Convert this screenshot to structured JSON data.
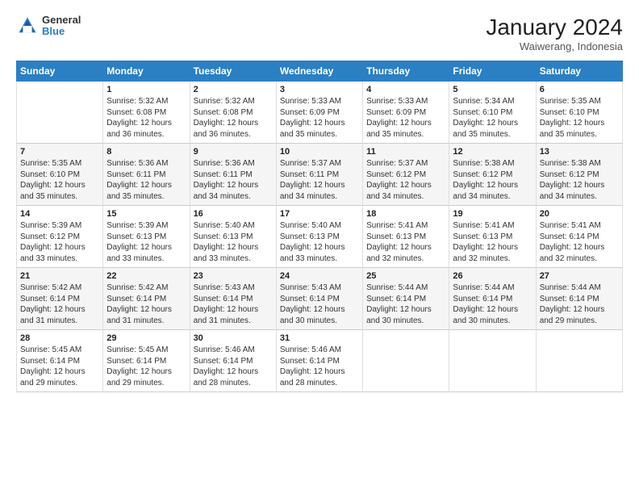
{
  "logo": {
    "general": "General",
    "blue": "Blue"
  },
  "title": {
    "month": "January 2024",
    "location": "Waiwerang, Indonesia"
  },
  "headers": [
    "Sunday",
    "Monday",
    "Tuesday",
    "Wednesday",
    "Thursday",
    "Friday",
    "Saturday"
  ],
  "weeks": [
    [
      {
        "day": "",
        "info": ""
      },
      {
        "day": "1",
        "info": "Sunrise: 5:32 AM\nSunset: 6:08 PM\nDaylight: 12 hours and 36 minutes."
      },
      {
        "day": "2",
        "info": "Sunrise: 5:32 AM\nSunset: 6:08 PM\nDaylight: 12 hours and 36 minutes."
      },
      {
        "day": "3",
        "info": "Sunrise: 5:33 AM\nSunset: 6:09 PM\nDaylight: 12 hours and 35 minutes."
      },
      {
        "day": "4",
        "info": "Sunrise: 5:33 AM\nSunset: 6:09 PM\nDaylight: 12 hours and 35 minutes."
      },
      {
        "day": "5",
        "info": "Sunrise: 5:34 AM\nSunset: 6:10 PM\nDaylight: 12 hours and 35 minutes."
      },
      {
        "day": "6",
        "info": "Sunrise: 5:35 AM\nSunset: 6:10 PM\nDaylight: 12 hours and 35 minutes."
      }
    ],
    [
      {
        "day": "7",
        "info": "Sunrise: 5:35 AM\nSunset: 6:10 PM\nDaylight: 12 hours and 35 minutes."
      },
      {
        "day": "8",
        "info": "Sunrise: 5:36 AM\nSunset: 6:11 PM\nDaylight: 12 hours and 35 minutes."
      },
      {
        "day": "9",
        "info": "Sunrise: 5:36 AM\nSunset: 6:11 PM\nDaylight: 12 hours and 34 minutes."
      },
      {
        "day": "10",
        "info": "Sunrise: 5:37 AM\nSunset: 6:11 PM\nDaylight: 12 hours and 34 minutes."
      },
      {
        "day": "11",
        "info": "Sunrise: 5:37 AM\nSunset: 6:12 PM\nDaylight: 12 hours and 34 minutes."
      },
      {
        "day": "12",
        "info": "Sunrise: 5:38 AM\nSunset: 6:12 PM\nDaylight: 12 hours and 34 minutes."
      },
      {
        "day": "13",
        "info": "Sunrise: 5:38 AM\nSunset: 6:12 PM\nDaylight: 12 hours and 34 minutes."
      }
    ],
    [
      {
        "day": "14",
        "info": "Sunrise: 5:39 AM\nSunset: 6:12 PM\nDaylight: 12 hours and 33 minutes."
      },
      {
        "day": "15",
        "info": "Sunrise: 5:39 AM\nSunset: 6:13 PM\nDaylight: 12 hours and 33 minutes."
      },
      {
        "day": "16",
        "info": "Sunrise: 5:40 AM\nSunset: 6:13 PM\nDaylight: 12 hours and 33 minutes."
      },
      {
        "day": "17",
        "info": "Sunrise: 5:40 AM\nSunset: 6:13 PM\nDaylight: 12 hours and 33 minutes."
      },
      {
        "day": "18",
        "info": "Sunrise: 5:41 AM\nSunset: 6:13 PM\nDaylight: 12 hours and 32 minutes."
      },
      {
        "day": "19",
        "info": "Sunrise: 5:41 AM\nSunset: 6:13 PM\nDaylight: 12 hours and 32 minutes."
      },
      {
        "day": "20",
        "info": "Sunrise: 5:41 AM\nSunset: 6:14 PM\nDaylight: 12 hours and 32 minutes."
      }
    ],
    [
      {
        "day": "21",
        "info": "Sunrise: 5:42 AM\nSunset: 6:14 PM\nDaylight: 12 hours and 31 minutes."
      },
      {
        "day": "22",
        "info": "Sunrise: 5:42 AM\nSunset: 6:14 PM\nDaylight: 12 hours and 31 minutes."
      },
      {
        "day": "23",
        "info": "Sunrise: 5:43 AM\nSunset: 6:14 PM\nDaylight: 12 hours and 31 minutes."
      },
      {
        "day": "24",
        "info": "Sunrise: 5:43 AM\nSunset: 6:14 PM\nDaylight: 12 hours and 30 minutes."
      },
      {
        "day": "25",
        "info": "Sunrise: 5:44 AM\nSunset: 6:14 PM\nDaylight: 12 hours and 30 minutes."
      },
      {
        "day": "26",
        "info": "Sunrise: 5:44 AM\nSunset: 6:14 PM\nDaylight: 12 hours and 30 minutes."
      },
      {
        "day": "27",
        "info": "Sunrise: 5:44 AM\nSunset: 6:14 PM\nDaylight: 12 hours and 29 minutes."
      }
    ],
    [
      {
        "day": "28",
        "info": "Sunrise: 5:45 AM\nSunset: 6:14 PM\nDaylight: 12 hours and 29 minutes."
      },
      {
        "day": "29",
        "info": "Sunrise: 5:45 AM\nSunset: 6:14 PM\nDaylight: 12 hours and 29 minutes."
      },
      {
        "day": "30",
        "info": "Sunrise: 5:46 AM\nSunset: 6:14 PM\nDaylight: 12 hours and 28 minutes."
      },
      {
        "day": "31",
        "info": "Sunrise: 5:46 AM\nSunset: 6:14 PM\nDaylight: 12 hours and 28 minutes."
      },
      {
        "day": "",
        "info": ""
      },
      {
        "day": "",
        "info": ""
      },
      {
        "day": "",
        "info": ""
      }
    ]
  ]
}
